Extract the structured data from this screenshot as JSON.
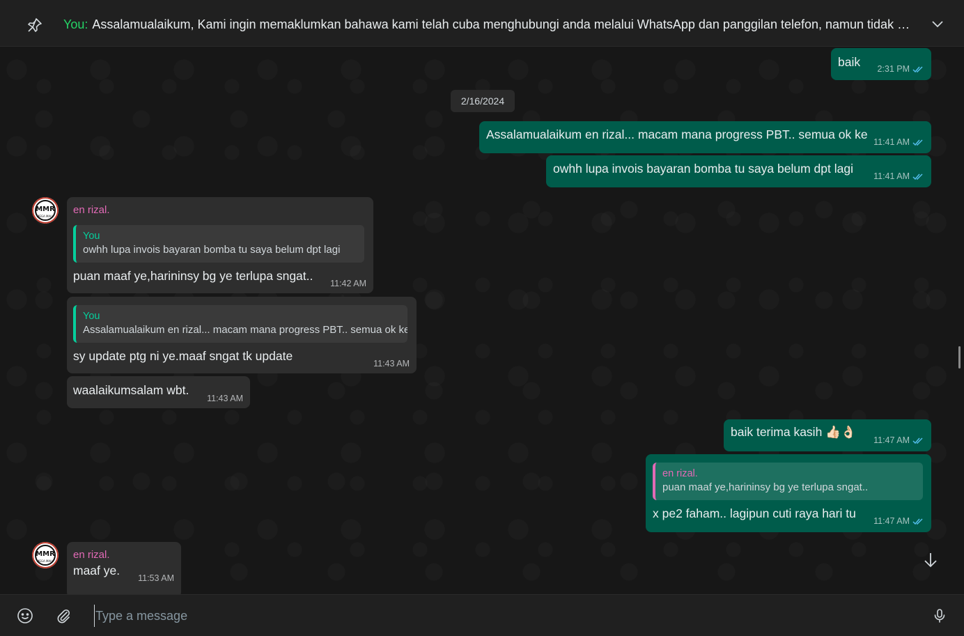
{
  "pinned": {
    "sender": "You:",
    "text": "Assalamualaikum,  Kami ingin memaklumkan bahawa kami telah cuba menghubungi anda melalui WhatsApp dan panggilan telefon, namun tidak mener..."
  },
  "date_chip": "2/16/2024",
  "messages": [
    {
      "text": "baik",
      "time": "2:31 PM"
    },
    {
      "text": "Assalamualaikum en rizal... macam mana progress PBT.. semua ok ke",
      "time": "11:41 AM"
    },
    {
      "text": "owhh lupa invois bayaran bomba tu saya belum dpt lagi",
      "time": "11:41 AM"
    },
    {
      "sender": "en rizal.",
      "quote_name": "You",
      "quote_text": "owhh lupa invois bayaran bomba tu saya belum dpt lagi",
      "text": "puan maaf ye,harininsy bg ye terlupa sngat..",
      "time": "11:42 AM"
    },
    {
      "quote_name": "You",
      "quote_text": "Assalamualaikum en rizal... macam mana progress PBT.. semua ok ke",
      "text": "sy update ptg ni ye.maaf sngat tk update",
      "time": "11:43 AM"
    },
    {
      "text": "waalaikumsalam wbt.",
      "time": "11:43 AM"
    },
    {
      "text": "baik terima kasih 👍🏻👌🏻",
      "time": "11:47 AM"
    },
    {
      "quote_name": "en rizal.",
      "quote_text": "puan maaf ye,harininsy bg ye terlupa sngat..",
      "text": "x pe2 faham.. lagipun cuti raya hari tu",
      "time": "11:47 AM"
    },
    {
      "sender": "en rizal.",
      "text": "maaf ye.",
      "time": "11:53 AM"
    }
  ],
  "avatar": {
    "label": "MMR",
    "sub": "MEGA MALU"
  },
  "composer": {
    "placeholder": "Type a message"
  },
  "colors": {
    "outgoing": "#005c4b",
    "incoming": "#2e2e2e",
    "accent": "#25d366",
    "sender": "#e26ab6"
  }
}
